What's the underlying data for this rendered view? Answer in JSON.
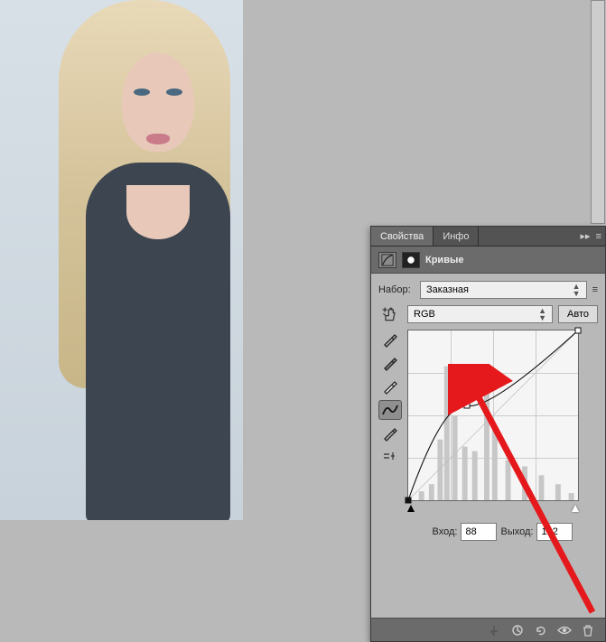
{
  "tabs": {
    "properties": "Свойства",
    "info": "Инфо"
  },
  "header": {
    "title": "Кривые"
  },
  "preset": {
    "label": "Набор:",
    "value": "Заказная"
  },
  "channel": {
    "value": "RGB",
    "auto_label": "Авто"
  },
  "io": {
    "input_label": "Вход:",
    "input_value": "88",
    "output_label": "Выход:",
    "output_value": "142"
  },
  "chart_data": {
    "type": "line",
    "title": "Кривые",
    "xlabel": "Вход",
    "ylabel": "Выход",
    "xlim": [
      0,
      255
    ],
    "ylim": [
      0,
      255
    ],
    "control_points": [
      {
        "x": 0,
        "y": 0
      },
      {
        "x": 88,
        "y": 142
      },
      {
        "x": 255,
        "y": 255
      }
    ],
    "histogram_peaks": [
      {
        "x": 20,
        "h": 10
      },
      {
        "x": 35,
        "h": 18
      },
      {
        "x": 48,
        "h": 68
      },
      {
        "x": 58,
        "h": 150
      },
      {
        "x": 70,
        "h": 95
      },
      {
        "x": 85,
        "h": 60
      },
      {
        "x": 100,
        "h": 55
      },
      {
        "x": 118,
        "h": 140
      },
      {
        "x": 130,
        "h": 80
      },
      {
        "x": 150,
        "h": 45
      },
      {
        "x": 175,
        "h": 38
      },
      {
        "x": 200,
        "h": 28
      },
      {
        "x": 225,
        "h": 18
      },
      {
        "x": 245,
        "h": 8
      }
    ]
  },
  "icons": {
    "curves_preset": "⧉",
    "mask": "◯",
    "expand": "▸▸",
    "menu": "≡"
  }
}
